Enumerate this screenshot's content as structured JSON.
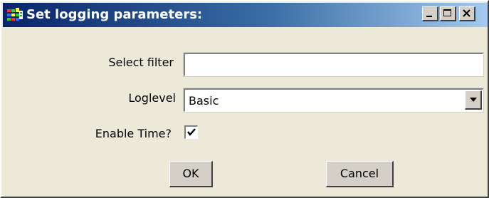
{
  "window": {
    "title": "Set logging parameters:",
    "icon": "app-grid-icon"
  },
  "titlebar_buttons": [
    {
      "name": "minimize",
      "icon": "minimize-icon"
    },
    {
      "name": "maximize",
      "icon": "maximize-icon"
    },
    {
      "name": "close",
      "icon": "close-icon"
    }
  ],
  "form": {
    "filter_label": "Select filter",
    "filter_value": "",
    "loglevel_label": "Loglevel",
    "loglevel_value": "Basic",
    "time_label": "Enable Time?",
    "time_checked": true
  },
  "buttons": {
    "ok_label": "OK",
    "cancel_label": "Cancel"
  },
  "colors": {
    "titlebar_start": "#0a246a",
    "titlebar_end": "#a6caf0",
    "dialog_bg": "#ece9d8",
    "button_face": "#d4d0c8"
  }
}
